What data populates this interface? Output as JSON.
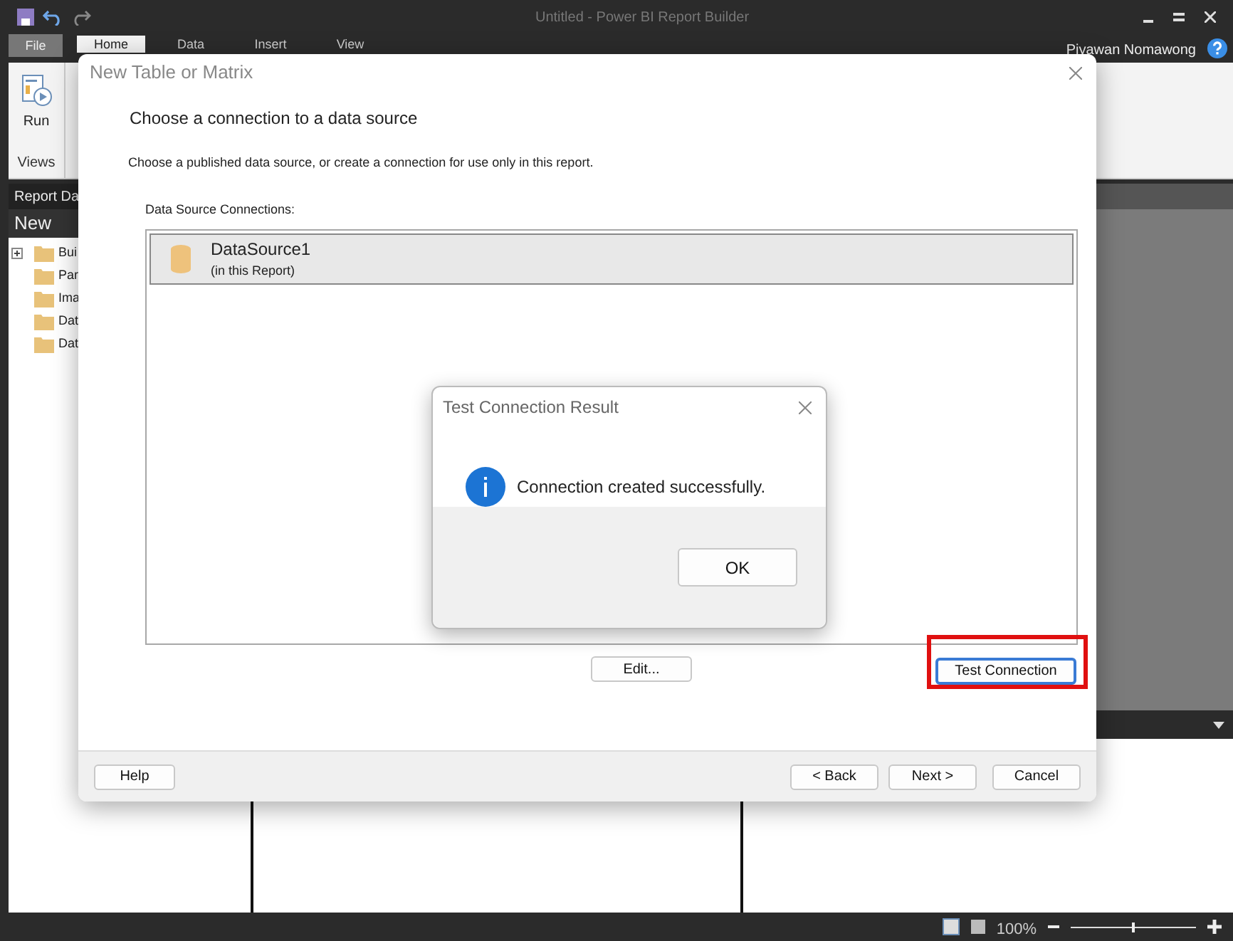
{
  "window": {
    "title": "Untitled - Power BI Report Builder"
  },
  "ribbon_tabs": [
    {
      "label": "File",
      "kind": "file",
      "selected": false
    },
    {
      "label": "Home",
      "kind": "tab",
      "selected": true
    },
    {
      "label": "Data",
      "kind": "tab",
      "selected": false
    },
    {
      "label": "Insert",
      "kind": "tab",
      "selected": false
    },
    {
      "label": "View",
      "kind": "tab",
      "selected": false
    }
  ],
  "user": "Piyawan Nomawong",
  "ribbon": {
    "run_label": "Run",
    "group_label": "Views"
  },
  "report_data": {
    "title": "Report Da",
    "new_label": "New",
    "items": [
      {
        "label": "Bui",
        "kind": "expandable"
      },
      {
        "label": "Par",
        "kind": "plain"
      },
      {
        "label": "Ima",
        "kind": "plain"
      },
      {
        "label": "Dat",
        "kind": "plain"
      },
      {
        "label": "Dat",
        "kind": "plain"
      }
    ]
  },
  "status_bar": {
    "zoom": "100%",
    "level": 0.5
  },
  "wizard": {
    "title": "New Table or Matrix",
    "heading": "Choose a connection to a data source",
    "description": "Choose a published data source, or create a connection for use only in this report.",
    "list_label": "Data Source Connections:",
    "connections": [
      {
        "name": "DataSource1",
        "location": "(in this Report)",
        "selected": true
      }
    ],
    "edit_button": "Edit...",
    "test_button": {
      "label": "Test Connection",
      "highlighted": true
    },
    "footer_buttons": [
      "Help",
      "< Back",
      "Next >",
      "Cancel"
    ]
  },
  "message_box": {
    "title": "Test Connection Result",
    "message": "Connection created successfully.",
    "button": "OK"
  }
}
